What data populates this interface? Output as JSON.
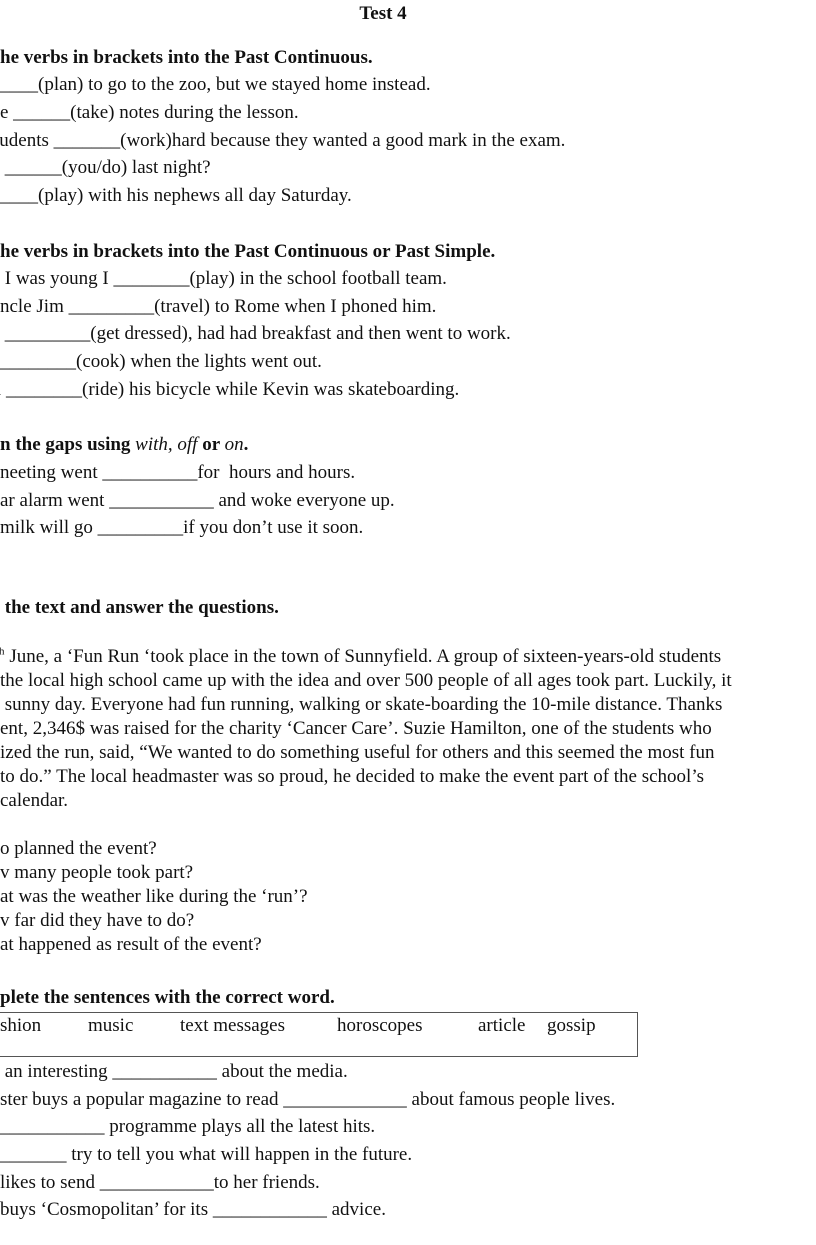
{
  "title": "Test 4",
  "sections": [
    {
      "heading": "he verbs in brackets into the Past Continuous.",
      "items": [
        "____(plan) to go to the zoo, but we stayed home instead.",
        "e ______(take) notes during the lesson.",
        "tudents _______(work)hard because they wanted a good mark in the exam.",
        " ______(you/do) last night?",
        "____(play) with his nephews all day Saturday."
      ]
    },
    {
      "heading": "he verbs in brackets into the Past Continuous or Past Simple.",
      "items": [
        " I was young I ________(play) in the school football team.",
        "ncle Jim _________(travel) to Rome when I phoned him.",
        " _________(get dressed), had had breakfast and then went to work.",
        "________(cook) when the lights went out.",
        "l ________(ride) his bicycle while Kevin was skateboarding."
      ]
    },
    {
      "heading_prefix": "n the gaps using ",
      "heading_italic_1": "with, off",
      "heading_mid": " or ",
      "heading_italic_2": "on",
      "heading_suffix": ".",
      "items": [
        "neeting went __________for  hours and hours.",
        "ar alarm went ___________ and woke everyone up.",
        "milk will go _________if you don’t use it soon."
      ]
    },
    {
      "heading": " the text and answer the questions.",
      "passage": {
        "first_line_sup": "th",
        "first_line_rest": " June, a ‘Fun Run ‘took place in the town of Sunnyfield. A group of sixteen-years-old students",
        "lines": [
          "the local high school came up with the idea and over 500 people of all ages took part. Luckily, it",
          " sunny day. Everyone had fun running, walking or skate-boarding the 10-mile distance. Thanks",
          "ent, 2,346$ was raised for the charity ‘Cancer Care’. Suzie Hamilton, one of the students who",
          "ized the run, said, “We wanted to do something useful for others and this seemed the most fun",
          "to do.” The local headmaster was so proud, he decided to make the event part of the school’s",
          "calendar."
        ]
      },
      "questions": [
        "o planned the event?",
        "v many people took part?",
        "at was the weather like during the ‘run’?",
        "v far did they have to do?",
        "at happened as result of the event?"
      ]
    },
    {
      "heading": "plete the sentences with the correct word.",
      "word_bank": [
        "shion",
        "music",
        "text messages",
        "horoscopes",
        "article",
        "gossip"
      ],
      "items": [
        " an interesting ___________ about the media.",
        "ster buys a popular magazine to read _____________ about famous people lives.",
        "___________ programme plays all the latest hits.",
        "_______ try to tell you what will happen in the future.",
        "likes to send ____________to her friends.",
        "buys ‘Cosmopolitan’ for its ____________ advice."
      ]
    }
  ]
}
